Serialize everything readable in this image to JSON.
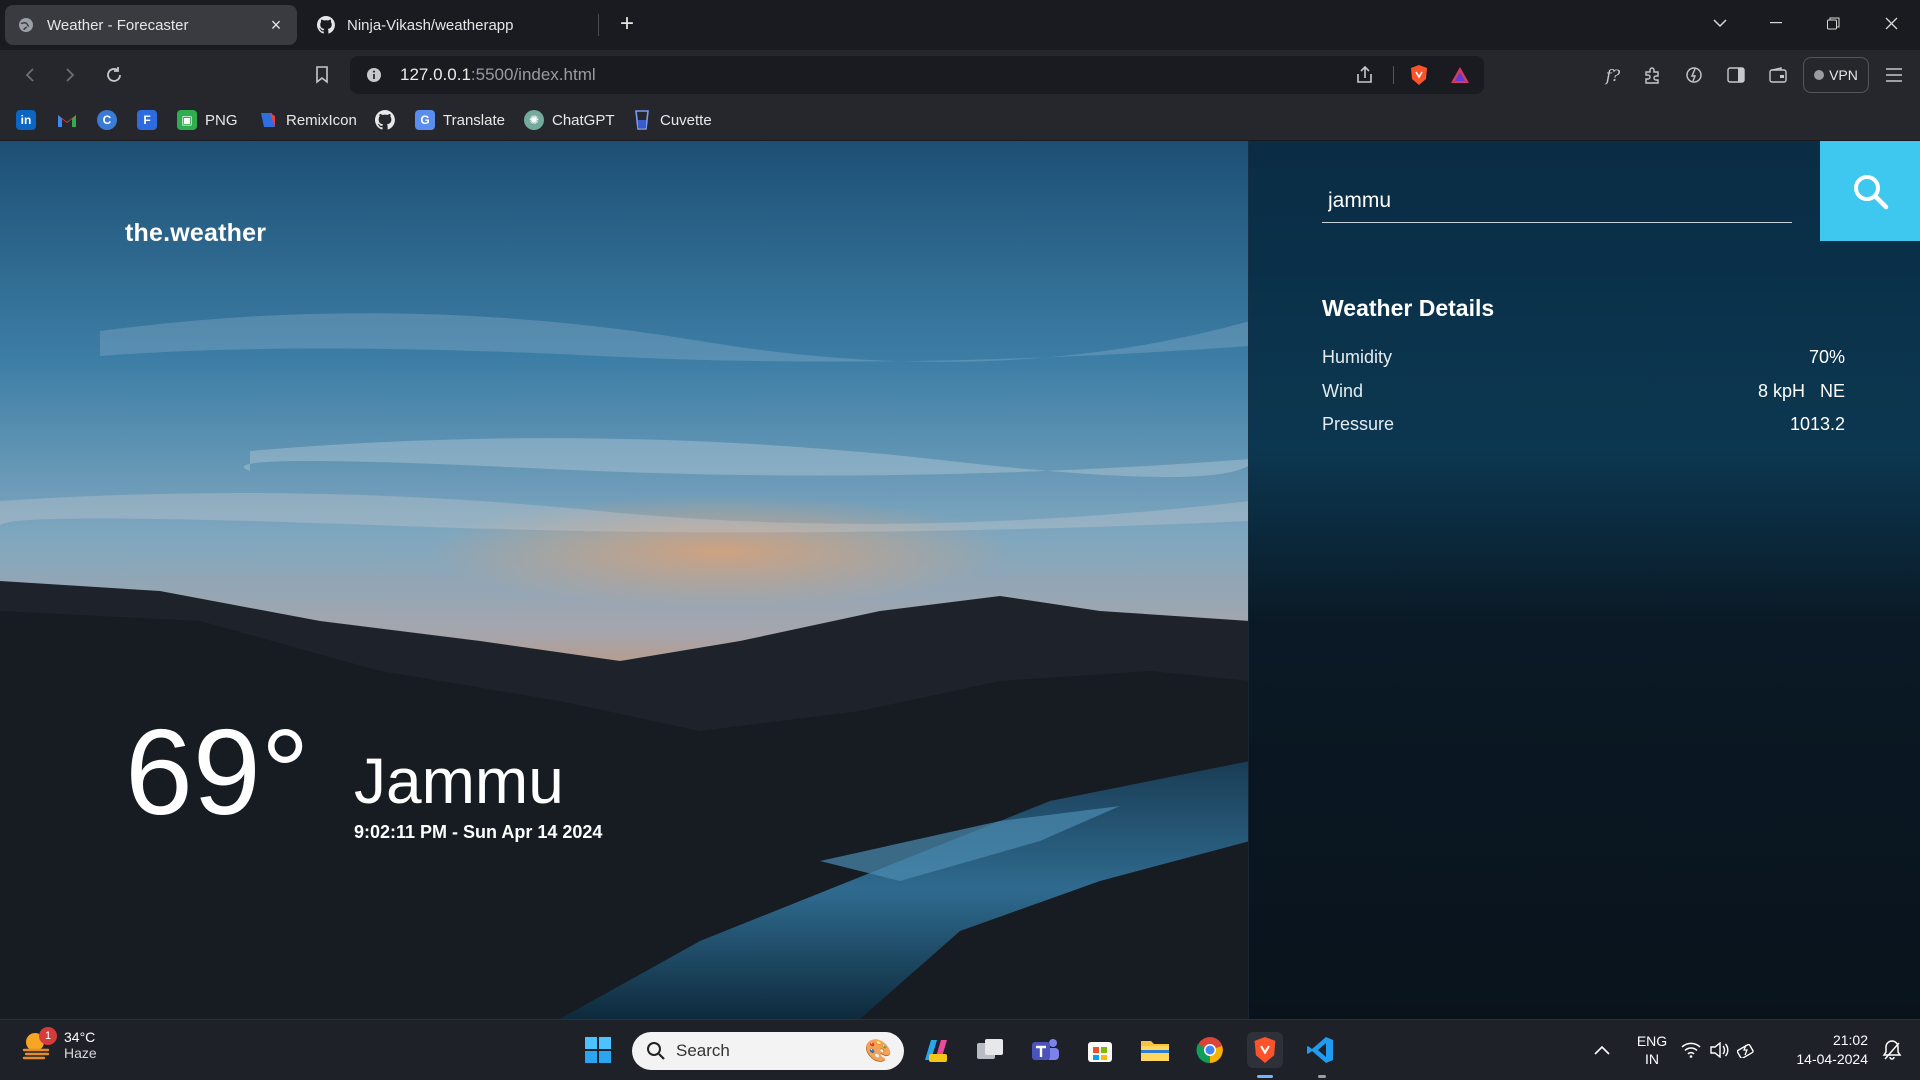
{
  "browser": {
    "tabs": [
      {
        "title": "Weather - Forecaster",
        "active": true
      },
      {
        "title": "Ninja-Vikash/weatherapp",
        "active": false
      }
    ],
    "url_host": "127.0.0.1",
    "url_rest": ":5500/index.html",
    "vpn_label": "VPN",
    "bookmarks": [
      {
        "label": "",
        "icon": "linkedin-icon"
      },
      {
        "label": "",
        "icon": "gmail-icon"
      },
      {
        "label": "",
        "icon": "canva-icon"
      },
      {
        "label": "",
        "icon": "forms-icon"
      },
      {
        "label": "PNG",
        "icon": "png-icon"
      },
      {
        "label": "RemixIcon",
        "icon": "remixicon-icon"
      },
      {
        "label": "",
        "icon": "github-icon"
      },
      {
        "label": "Translate",
        "icon": "translate-icon"
      },
      {
        "label": "ChatGPT",
        "icon": "chatgpt-icon"
      },
      {
        "label": "Cuvette",
        "icon": "cuvette-icon"
      }
    ]
  },
  "app": {
    "brand": "the.weather",
    "temperature": "69°",
    "city": "Jammu",
    "datetime": "9:02:11 PM - Sun Apr 14 2024",
    "search_value": "jammu",
    "details_title": "Weather Details",
    "details": [
      {
        "label": "Humidity",
        "value": "70%"
      },
      {
        "label": "Wind",
        "value": "8 kpH   NE"
      },
      {
        "label": "Pressure",
        "value": "1013.2"
      }
    ],
    "accent_color": "#3ec8ef"
  },
  "taskbar": {
    "weather_temp": "34°C",
    "weather_desc": "Haze",
    "notification_count": "1",
    "search_label": "Search",
    "language": "ENG",
    "region": "IN",
    "time": "21:02",
    "date": "14-04-2024"
  }
}
